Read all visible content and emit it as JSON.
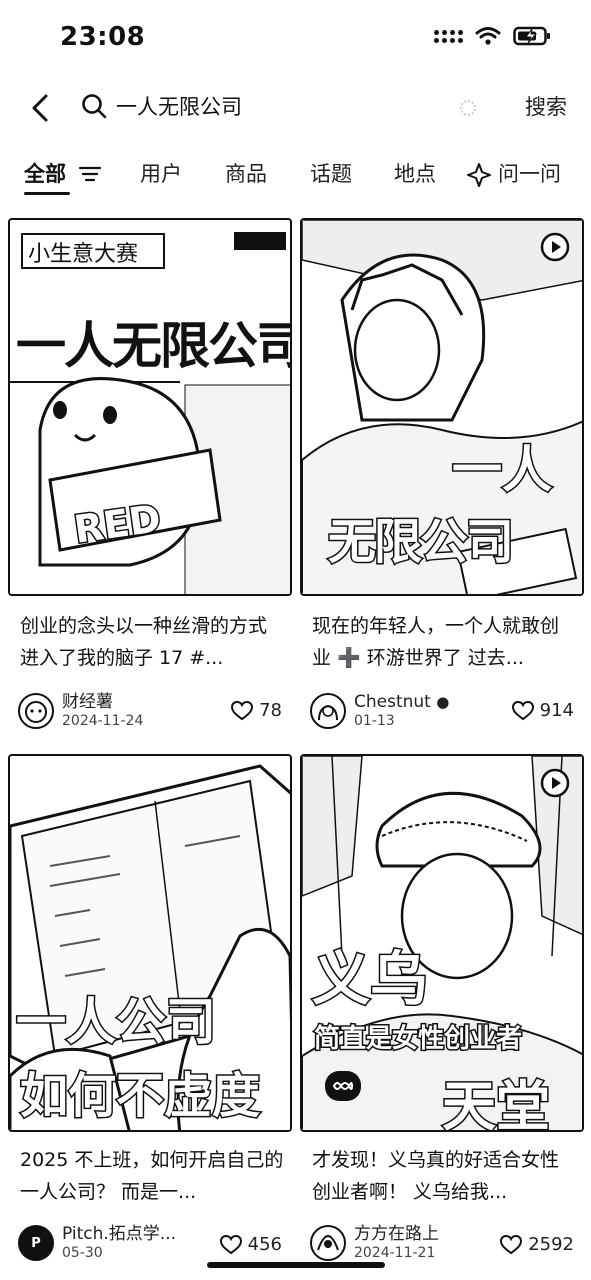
{
  "status_bar": {
    "time": "23:08"
  },
  "search": {
    "query": "一人无限公司",
    "submit_label": "搜索"
  },
  "tabs": [
    {
      "label": "全部"
    },
    {
      "label": "用户"
    },
    {
      "label": "商品"
    },
    {
      "label": "话题"
    },
    {
      "label": "地点"
    },
    {
      "label": "问一问"
    }
  ],
  "feed": [
    {
      "title": "创业的念头以一种丝滑的方式进入了我的脑子 17 #...",
      "author": "财经薯",
      "date": "2024-11-24",
      "likes": "78",
      "cover": {
        "tag": "小生意大赛",
        "headline": "一人无限公司",
        "badge": "RED"
      }
    },
    {
      "title": "现在的年轻人，一个人就敢创业 ➕ 环游世界了 过去...",
      "author": "Chestnut",
      "date": "01-13",
      "likes": "914",
      "cover": {
        "line1": "一人",
        "line2": "无限公司"
      }
    },
    {
      "title": "2025 不上班，如何开启自己的一人公司？ 而是一...",
      "author": "Pitch.拓点学...",
      "date": "05-30",
      "likes": "456",
      "cover": {
        "line1": "一人公司",
        "line2": "如何不虚度"
      }
    },
    {
      "title": "才发现！义乌真的好适合女性创业者啊！ 义乌给我...",
      "author": "方方在路上",
      "date": "2024-11-21",
      "likes": "2592",
      "cover": {
        "line1": "义乌",
        "line2": "简直是女性创业者",
        "line3": "天堂"
      }
    }
  ]
}
